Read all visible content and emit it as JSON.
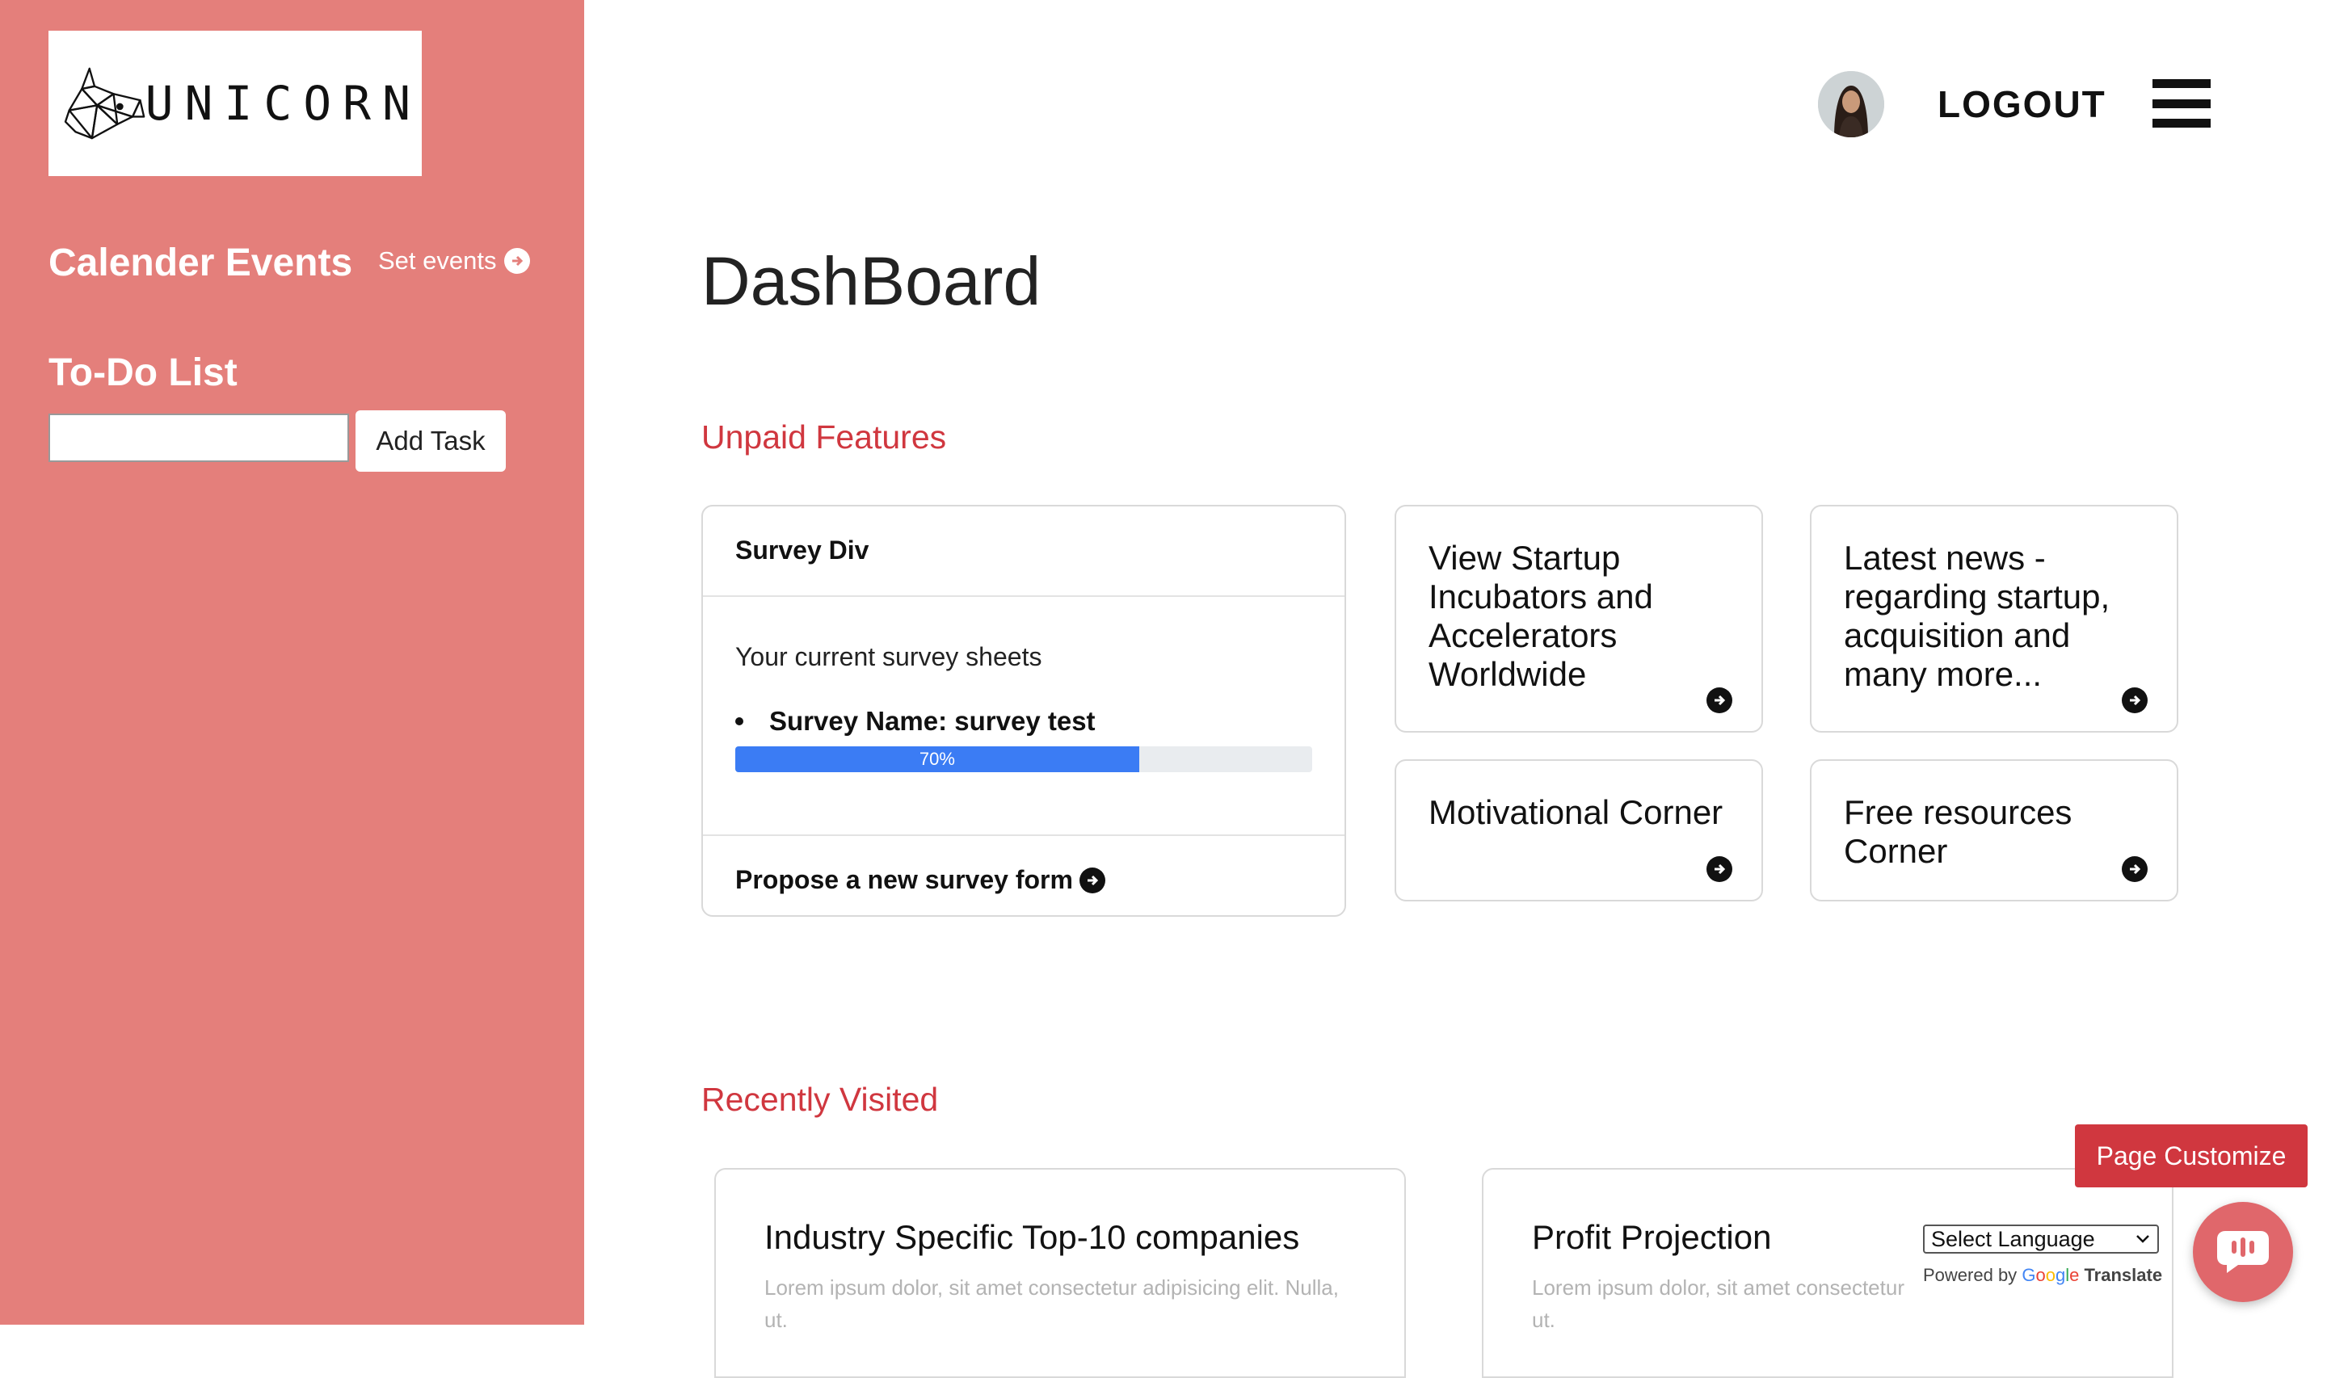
{
  "brand": {
    "logo_text": "UNICORN"
  },
  "sidebar": {
    "calendar_heading": "Calender Events",
    "set_events_label": "Set events",
    "todo_heading": "To-Do List",
    "todo_input_value": "",
    "add_task_label": "Add Task"
  },
  "header": {
    "logout_label": "LOGOUT"
  },
  "page_title": "DashBoard",
  "unpaid": {
    "title": "Unpaid Features",
    "survey": {
      "header": "Survey Div",
      "subtitle": "Your current survey sheets",
      "item_label": "Survey Name: survey test",
      "progress_label": "70%",
      "progress_fraction": 0.7,
      "footer_label": "Propose a new survey form"
    },
    "features": [
      {
        "label": "View Startup Incubators and Accelerators Worldwide"
      },
      {
        "label": "Latest news - regarding startup, acquisition and many more..."
      },
      {
        "label": "Motivational Corner"
      },
      {
        "label": "Free resources Corner"
      }
    ]
  },
  "recent": {
    "title": "Recently Visited",
    "cards": [
      {
        "title": "Industry Specific Top-10 companies",
        "text": "Lorem ipsum dolor, sit amet consectetur adipisicing elit. Nulla, ut."
      },
      {
        "title": "Profit Projection",
        "text": "Lorem ipsum dolor, sit amet consectetur ut."
      }
    ]
  },
  "translate": {
    "select_label": "Select Language",
    "powered_by": "Powered by",
    "g": "G",
    "o1": "o",
    "o2": "o",
    "g2": "g",
    "l": "l",
    "e": "e",
    "translate_word": "Translate"
  },
  "page_customize_label": "Page Customize",
  "colors": {
    "sidebar": "#e47f7b",
    "accent": "#d0373f",
    "progress": "#3b7cf4"
  }
}
